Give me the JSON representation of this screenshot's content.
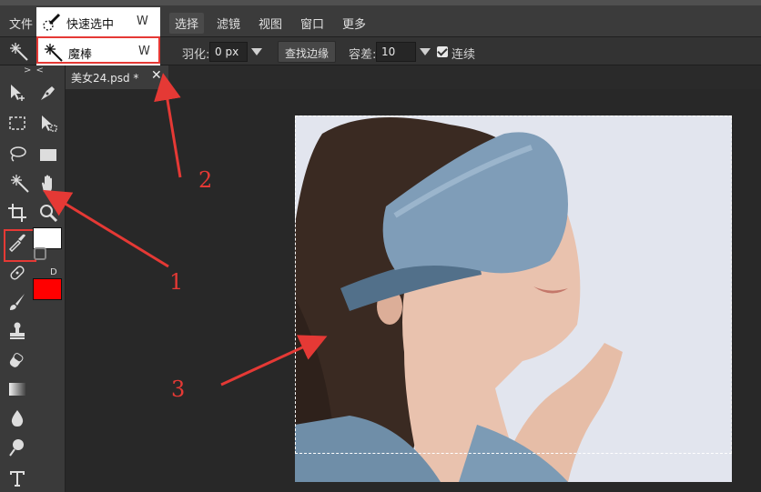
{
  "menubar": {
    "items": [
      "文件",
      "选择",
      "滤镜",
      "视图",
      "窗口",
      "更多"
    ],
    "active_index": 1
  },
  "tool_dropdown": {
    "items": [
      {
        "label": "快速选中",
        "shortcut": "W",
        "icon": "quick-selection-icon"
      },
      {
        "label": "魔棒",
        "shortcut": "W",
        "icon": "magic-wand-icon"
      }
    ],
    "highlighted_index": 1
  },
  "options": {
    "feather_label": "羽化:",
    "feather_value": "0",
    "feather_unit": "px",
    "refine_edge_label": "查找边缘",
    "tolerance_label": "容差:",
    "tolerance_value": "10",
    "contiguous_label": "连续",
    "contiguous_checked": true
  },
  "toolbar": {
    "collapse_label": "> <",
    "default_colors_label": "D",
    "foreground_color": "#ffffff",
    "background_color": "#ff0000",
    "tools": [
      "move-icon",
      "pen-icon",
      "marquee-icon",
      "direct-select-icon",
      "lasso-icon",
      "rectangle-icon",
      "magic-wand-icon",
      "hand-icon",
      "crop-icon",
      "zoom-icon",
      "eyedropper-icon",
      "healing-brush-icon",
      "brush-icon",
      "stamp-icon",
      "eraser-icon",
      "gradient-icon",
      "blur-icon",
      "dodge-icon",
      "type-icon"
    ]
  },
  "document": {
    "tab_title": "美女24.psd *",
    "close_symbol": "✕"
  },
  "annotations": {
    "labels": [
      "1",
      "2",
      "3"
    ],
    "color": "#e53935"
  }
}
